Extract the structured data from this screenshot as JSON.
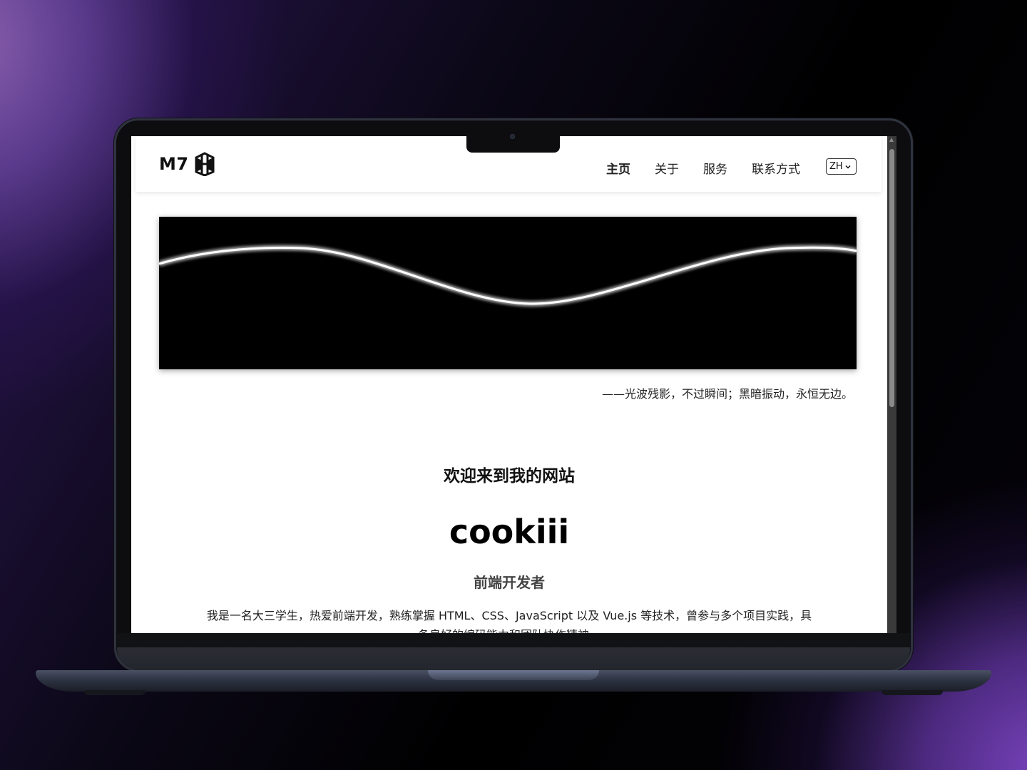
{
  "navbar": {
    "logo_text": "M7",
    "links": [
      {
        "label": "主页"
      },
      {
        "label": "关于"
      },
      {
        "label": "服务"
      },
      {
        "label": "联系方式"
      }
    ],
    "language": "ZH"
  },
  "hero": {
    "quote": "——光波残影，不过瞬间；黑暗振动，永恒无边。"
  },
  "intro": {
    "welcome": "欢迎来到我的网站",
    "name": "cookiii",
    "role": "前端开发者",
    "bio": "我是一名大三学生，热爱前端开发，熟练掌握 HTML、CSS、JavaScript 以及 Vue.js 等技术，曾参与多个项目实践，具备良好的编码能力和团队协作精神。"
  },
  "colors": {
    "hero_background": "#000000",
    "wave": "#ffffff",
    "page_background": "#ffffff"
  }
}
